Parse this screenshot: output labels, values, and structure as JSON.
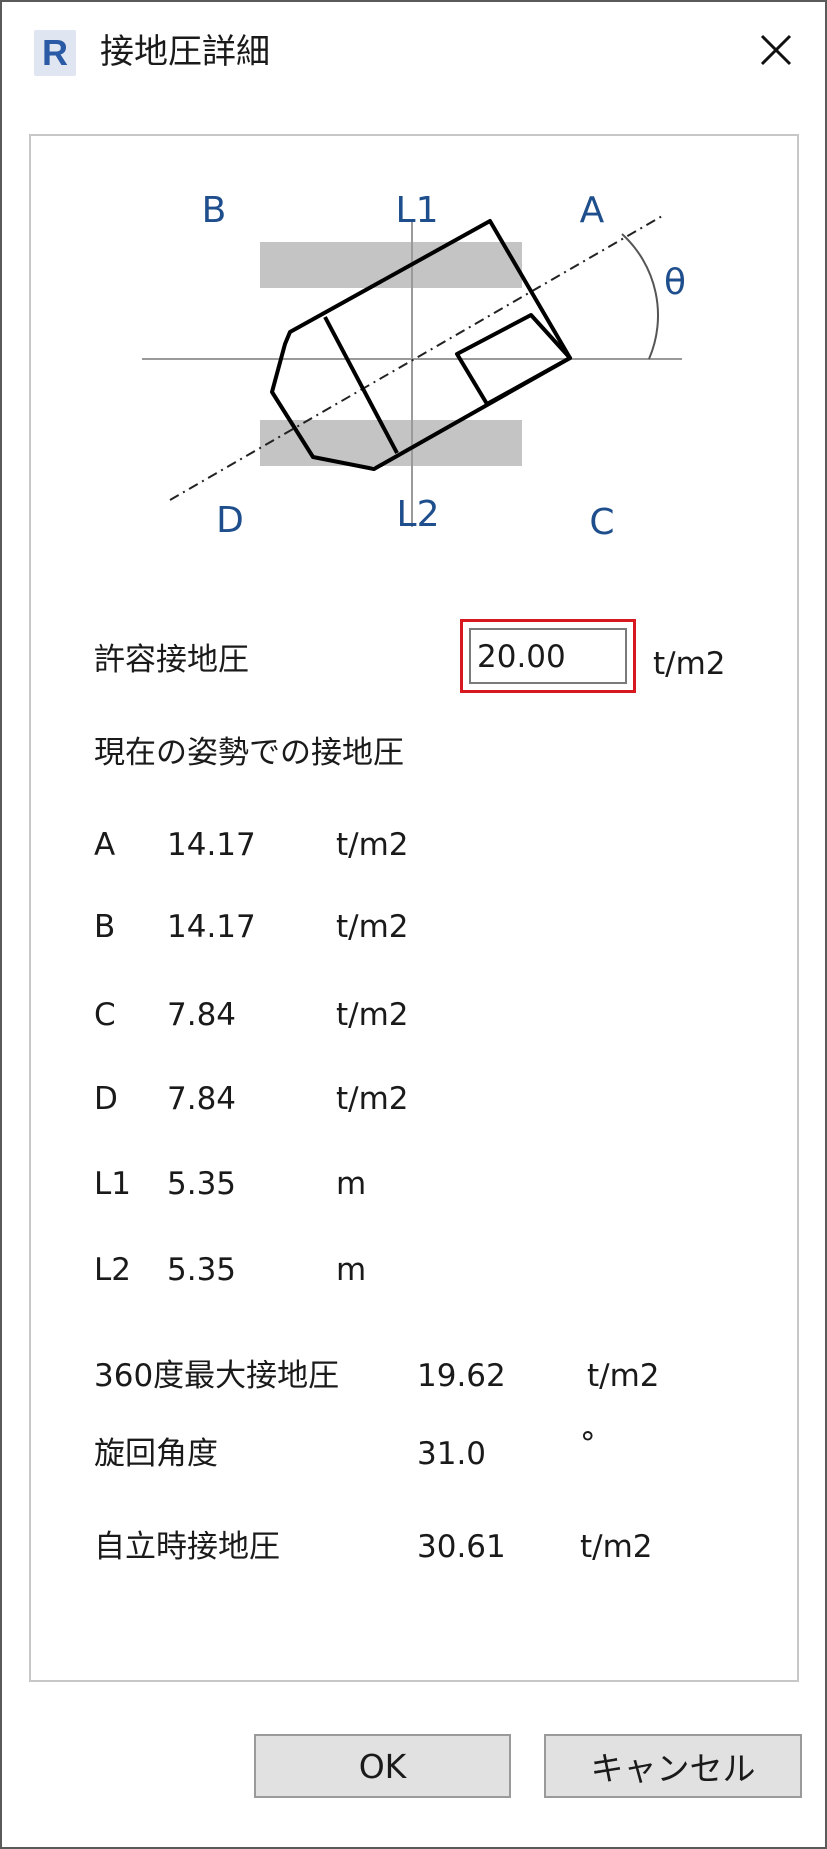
{
  "window": {
    "title": "接地圧詳細",
    "app_icon_letter": "R"
  },
  "diagram": {
    "labels": {
      "a": "A",
      "b": "B",
      "c": "C",
      "d": "D",
      "l1": "L1",
      "l2": "L2",
      "theta": "θ"
    },
    "colors": {
      "label": "#1f4e8c",
      "pad": "#c4c4c4",
      "line": "#000000"
    }
  },
  "allowable": {
    "label": "許容接地圧",
    "value": "20.00",
    "unit": "t/m2"
  },
  "current_heading": "現在の姿勢での接地圧",
  "rows": [
    {
      "name": "A",
      "value": "14.17",
      "unit": "t/m2"
    },
    {
      "name": "B",
      "value": "14.17",
      "unit": "t/m2"
    },
    {
      "name": "C",
      "value": "7.84",
      "unit": "t/m2"
    },
    {
      "name": "D",
      "value": "7.84",
      "unit": "t/m2"
    },
    {
      "name": "L1",
      "value": "5.35",
      "unit": "m"
    },
    {
      "name": "L2",
      "value": "5.35",
      "unit": "m"
    }
  ],
  "summary": [
    {
      "label": "360度最大接地圧",
      "value": "19.62",
      "unit": "t/m2"
    },
    {
      "label": "旋回角度",
      "value": "31.0",
      "unit": "°"
    },
    {
      "label": "自立時接地圧",
      "value": "30.61",
      "unit": "t/m2"
    }
  ],
  "buttons": {
    "ok": "OK",
    "cancel": "キャンセル"
  },
  "accent": {
    "input_highlight": "#d7191f"
  }
}
